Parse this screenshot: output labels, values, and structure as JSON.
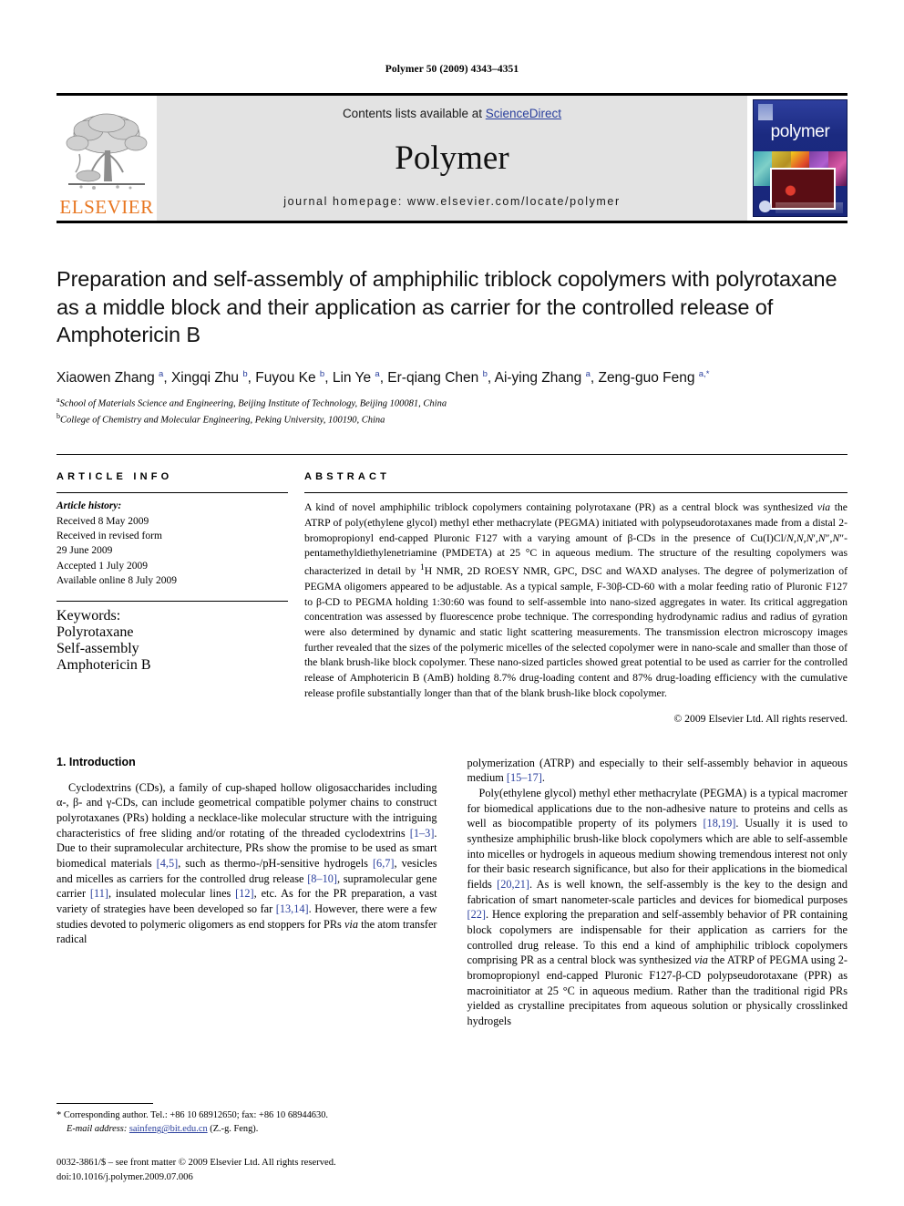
{
  "running_head": "Polymer 50 (2009) 4343–4351",
  "banner": {
    "publisher_name": "ELSEVIER",
    "contents_prefix": "Contents lists available at ",
    "contents_link": "ScienceDirect",
    "journal_name": "Polymer",
    "homepage": "journal homepage: www.elsevier.com/locate/polymer",
    "cover_title": "polymer"
  },
  "article": {
    "title": "Preparation and self-assembly of amphiphilic triblock copolymers with polyrotaxane as a middle block and their application as carrier for the controlled release of Amphotericin B",
    "authors_html": "Xiaowen Zhang <sup>a</sup>, Xingqi Zhu <sup>b</sup>, Fuyou Ke <sup>b</sup>, Lin Ye <sup>a</sup>, Er-qiang Chen <sup>b</sup>, Ai-ying Zhang <sup>a</sup>, Zeng-guo Feng <sup>a,</sup><sup>*</sup>",
    "affiliation_a": "School of Materials Science and Engineering, Beijing Institute of Technology, Beijing 100081, China",
    "affiliation_b": "College of Chemistry and Molecular Engineering, Peking University, 100190, China"
  },
  "article_info": {
    "heading": "ARTICLE INFO",
    "history_label": "Article history:",
    "history": [
      "Received 8 May 2009",
      "Received in revised form",
      "29 June 2009",
      "Accepted 1 July 2009",
      "Available online 8 July 2009"
    ],
    "keywords_label": "Keywords:",
    "keywords": [
      "Polyrotaxane",
      "Self-assembly",
      "Amphotericin B"
    ]
  },
  "abstract": {
    "heading": "ABSTRACT",
    "text": "A kind of novel amphiphilic triblock copolymers containing polyrotaxane (PR) as a central block was synthesized via the ATRP of poly(ethylene glycol) methyl ether methacrylate (PEGMA) initiated with polypseudorotaxanes made from a distal 2-bromopropionyl end-capped Pluronic F127 with a varying amount of β-CDs in the presence of Cu(I)Cl/N,N,N′,N″,N″-pentamethyldiethylenetriamine (PMDETA) at 25 °C in aqueous medium. The structure of the resulting copolymers was characterized in detail by 1H NMR, 2D ROESY NMR, GPC, DSC and WAXD analyses. The degree of polymerization of PEGMA oligomers appeared to be adjustable. As a typical sample, F-30β-CD-60 with a molar feeding ratio of Pluronic F127 to β-CD to PEGMA holding 1:30:60 was found to self-assemble into nano-sized aggregates in water. Its critical aggregation concentration was assessed by fluorescence probe technique. The corresponding hydrodynamic radius and radius of gyration were also determined by dynamic and static light scattering measurements. The transmission electron microscopy images further revealed that the sizes of the polymeric micelles of the selected copolymer were in nano-scale and smaller than those of the blank brush-like block copolymer. These nano-sized particles showed great potential to be used as carrier for the controlled release of Amphotericin B (AmB) holding 8.7% drug-loading content and 87% drug-loading efficiency with the cumulative release profile substantially longer than that of the blank brush-like block copolymer.",
    "copyright": "© 2009 Elsevier Ltd. All rights reserved."
  },
  "introduction": {
    "heading": "1. Introduction",
    "left_paragraph": "Cyclodextrins (CDs), a family of cup-shaped hollow oligosaccharides including α-, β- and γ-CDs, can include geometrical compatible polymer chains to construct polyrotaxanes (PRs) holding a necklace-like molecular structure with the intriguing characteristics of free sliding and/or rotating of the threaded cyclodextrins [1–3]. Due to their supramolecular architecture, PRs show the promise to be used as smart biomedical materials [4,5], such as thermo-/pH-sensitive hydrogels [6,7], vesicles and micelles as carriers for the controlled drug release [8–10], supramolecular gene carrier [11], insulated molecular lines [12], etc. As for the PR preparation, a vast variety of strategies have been developed so far [13,14]. However, there were a few studies devoted to polymeric oligomers as end stoppers for PRs via the atom transfer radical",
    "right_paragraph_1": "polymerization (ATRP) and especially to their self-assembly behavior in aqueous medium [15–17].",
    "right_paragraph_2": "Poly(ethylene glycol) methyl ether methacrylate (PEGMA) is a typical macromer for biomedical applications due to the non-adhesive nature to proteins and cells as well as biocompatible property of its polymers [18,19]. Usually it is used to synthesize amphiphilic brush-like block copolymers which are able to self-assemble into micelles or hydrogels in aqueous medium showing tremendous interest not only for their basic research significance, but also for their applications in the biomedical fields [20,21]. As is well known, the self-assembly is the key to the design and fabrication of smart nanometer-scale particles and devices for biomedical purposes [22]. Hence exploring the preparation and self-assembly behavior of PR containing block copolymers are indispensable for their application as carriers for the controlled drug release. To this end a kind of amphiphilic triblock copolymers comprising PR as a central block was synthesized via the ATRP of PEGMA using 2-bromopropionyl end-capped Pluronic F127-β-CD polypseudorotaxane (PPR) as macroinitiator at 25 °C in aqueous medium. Rather than the traditional rigid PRs yielded as crystalline precipitates from aqueous solution or physically crosslinked hydrogels"
  },
  "footer": {
    "corresponding_marker": "*",
    "corresponding_text": "Corresponding author. Tel.: +86 10 68912650; fax: +86 10 68944630.",
    "email_label": "E-mail address:",
    "email": "sainfeng@bit.edu.cn",
    "email_suffix": "(Z.-g. Feng).",
    "issn_line": "0032-3861/$ – see front matter © 2009 Elsevier Ltd. All rights reserved.",
    "doi_line": "doi:10.1016/j.polymer.2009.07.006"
  },
  "colors": {
    "elsevier_orange": "#E87722",
    "link_blue": "#2a3f9d",
    "banner_gray": "#e3e3e3",
    "cover_blue": "#1a2a7a"
  }
}
